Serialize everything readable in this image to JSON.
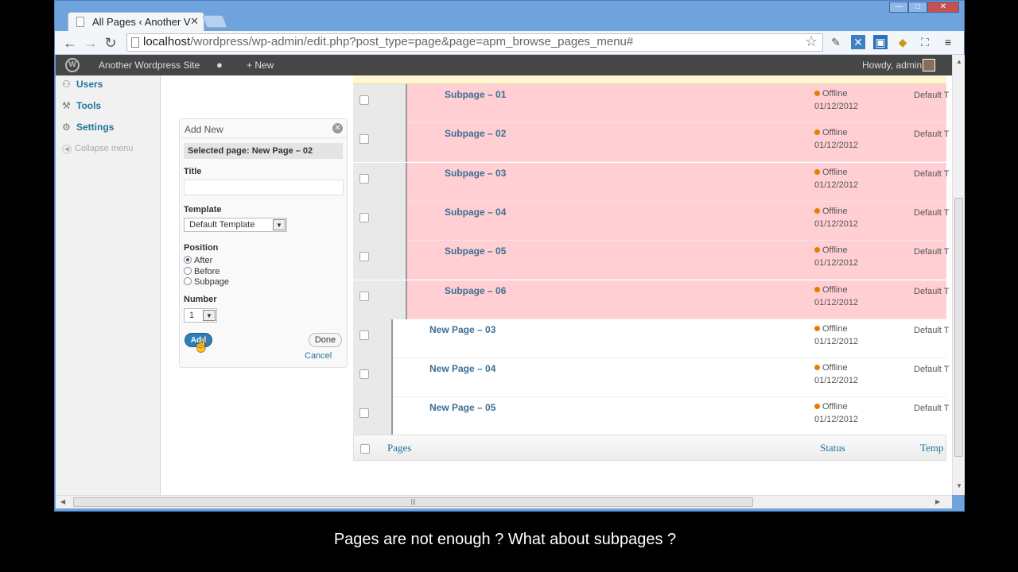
{
  "browser": {
    "tab_title": "All Pages ‹ Another V",
    "tab_close": "✕",
    "url_host": "localhost",
    "url_rest": "/wordpress/wp-admin/edit.php?post_type=page&page=apm_browse_pages_menu#",
    "min": "—",
    "max": "□",
    "close": "✕"
  },
  "adminbar": {
    "site_name": "Another Wordpress Site",
    "comments_icon": "speech-bubble-icon",
    "new_label": "+ New",
    "greeting": "Howdy, admin"
  },
  "sidebar": {
    "items": [
      {
        "label": "Users",
        "icon": "users-icon"
      },
      {
        "label": "Tools",
        "icon": "tools-icon"
      },
      {
        "label": "Settings",
        "icon": "settings-icon"
      }
    ],
    "collapse": "Collapse menu"
  },
  "add_new": {
    "header": "Add New",
    "selected": "Selected page: New Page – 02",
    "title_label": "Title",
    "title_value": "",
    "template_label": "Template",
    "template_value": "Default Template",
    "position_label": "Position",
    "positions": [
      "After",
      "Before",
      "Subpage"
    ],
    "selected_position": "After",
    "number_label": "Number",
    "number_value": "1",
    "add": "Add",
    "done": "Done",
    "cancel": "Cancel"
  },
  "rows": [
    {
      "title": "Subpage – 01",
      "status": "Offline",
      "date": "01/12/2012",
      "template": "Default T",
      "sub": true
    },
    {
      "title": "Subpage – 02",
      "status": "Offline",
      "date": "01/12/2012",
      "template": "Default T",
      "sub": true
    },
    {
      "title": "Subpage – 03",
      "status": "Offline",
      "date": "01/12/2012",
      "template": "Default T",
      "sub": true
    },
    {
      "title": "Subpage – 04",
      "status": "Offline",
      "date": "01/12/2012",
      "template": "Default T",
      "sub": true
    },
    {
      "title": "Subpage – 05",
      "status": "Offline",
      "date": "01/12/2012",
      "template": "Default T",
      "sub": true
    },
    {
      "title": "Subpage – 06",
      "status": "Offline",
      "date": "01/12/2012",
      "template": "Default T",
      "sub": true
    },
    {
      "title": "New Page – 03",
      "status": "Offline",
      "date": "01/12/2012",
      "template": "Default T",
      "sub": false
    },
    {
      "title": "New Page – 04",
      "status": "Offline",
      "date": "01/12/2012",
      "template": "Default T",
      "sub": false
    },
    {
      "title": "New Page – 05",
      "status": "Offline",
      "date": "01/12/2012",
      "template": "Default T",
      "sub": false
    }
  ],
  "footer": {
    "pages": "Pages",
    "status": "Status",
    "template": "Temp"
  },
  "hscroll_grip": "|||",
  "caption": "Pages are not enough ? What about subpages ?",
  "colors": {
    "subpage_row": "#ffcfd4",
    "status_dot": "#e67e00",
    "link": "#21759b",
    "add_button": "#2e7fb7"
  }
}
